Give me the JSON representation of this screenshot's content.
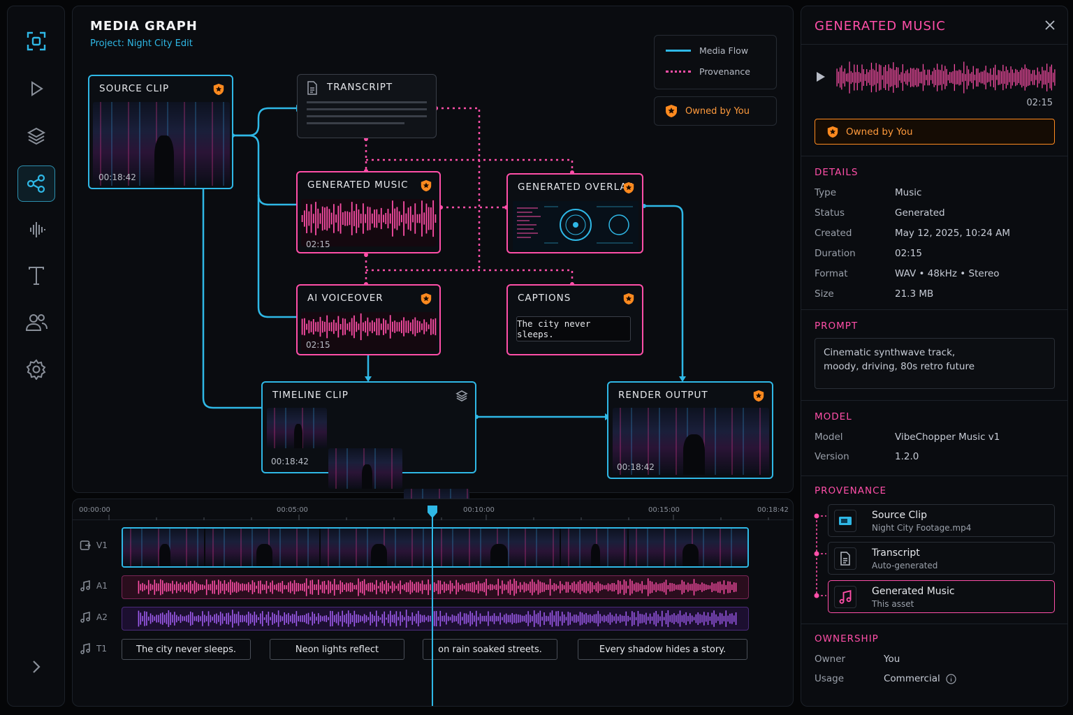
{
  "graph": {
    "title": "MEDIA GRAPH",
    "project": "Project: Night City Edit",
    "legend": {
      "media_flow": "Media Flow",
      "provenance": "Provenance"
    },
    "owned_badge": "Owned by You",
    "nodes": {
      "source_clip": {
        "title": "SOURCE CLIP",
        "time": "00:18:42"
      },
      "transcript": {
        "title": "TRANSCRIPT"
      },
      "generated_music": {
        "title": "GENERATED MUSIC",
        "time": "02:15"
      },
      "generated_overlay": {
        "title": "GENERATED OVERLAY"
      },
      "ai_voiceover": {
        "title": "AI VOICEOVER",
        "time": "02:15"
      },
      "captions": {
        "title": "CAPTIONS",
        "text": "The city never sleeps."
      },
      "timeline_clip": {
        "title": "TIMELINE CLIP",
        "time": "00:18:42"
      },
      "render_output": {
        "title": "RENDER OUTPUT",
        "time": "00:18:42"
      }
    }
  },
  "timeline": {
    "ruler": [
      "00:00:00",
      "00:05:00",
      "00:10:00",
      "00:15:00",
      "00:18:42"
    ],
    "tracks": {
      "v1": "V1",
      "a1": "A1",
      "a2": "A2",
      "t1": "T1"
    },
    "captions": [
      "The city never sleeps.",
      "Neon lights reflect",
      "on rain soaked streets.",
      "Every shadow hides a story."
    ]
  },
  "inspector": {
    "title": "GENERATED MUSIC",
    "duration": "02:15",
    "owned_badge": "Owned by You",
    "details": {
      "heading": "DETAILS",
      "rows": [
        {
          "k": "Type",
          "v": "Music"
        },
        {
          "k": "Status",
          "v": "Generated"
        },
        {
          "k": "Created",
          "v": "May 12, 2025, 10:24 AM"
        },
        {
          "k": "Duration",
          "v": "02:15"
        },
        {
          "k": "Format",
          "v": "WAV • 48kHz • Stereo"
        },
        {
          "k": "Size",
          "v": "21.3 MB"
        }
      ]
    },
    "prompt": {
      "heading": "PROMPT",
      "line1": "Cinematic synthwave track,",
      "line2": "moody, driving, 80s retro future"
    },
    "model": {
      "heading": "MODEL",
      "rows": [
        {
          "k": "Model",
          "v": "VibeChopper Music v1"
        },
        {
          "k": "Version",
          "v": "1.2.0"
        }
      ]
    },
    "provenance": {
      "heading": "PROVENANCE",
      "items": [
        {
          "name": "Source Clip",
          "sub": "Night City Footage.mp4"
        },
        {
          "name": "Transcript",
          "sub": "Auto-generated"
        },
        {
          "name": "Generated Music",
          "sub": "This asset"
        }
      ]
    },
    "ownership": {
      "heading": "OWNERSHIP",
      "rows": [
        {
          "k": "Owner",
          "v": "You"
        },
        {
          "k": "Usage",
          "v": "Commercial"
        }
      ]
    }
  },
  "colors": {
    "cyan": "#2fb8e6",
    "pink": "#ff4fa8",
    "orange": "#ff9a3c",
    "purple": "#a05cf0"
  },
  "icons": [
    "capture-icon",
    "play-icon",
    "layers-icon",
    "graph-icon",
    "waveform-icon",
    "text-icon",
    "users-icon",
    "settings-icon",
    "chevron-right-icon",
    "close-icon",
    "shield-icon",
    "info-icon"
  ]
}
